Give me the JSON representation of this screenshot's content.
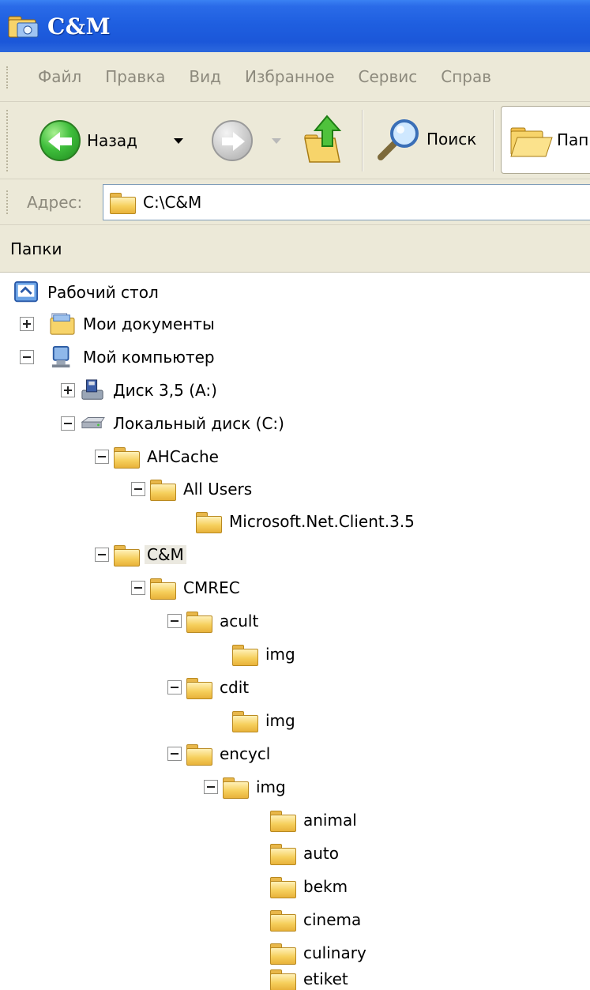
{
  "window": {
    "title": "C&M"
  },
  "menu": [
    "Файл",
    "Правка",
    "Вид",
    "Избранное",
    "Сервис",
    "Справ"
  ],
  "toolbar": {
    "back_label": "Назад",
    "search_label": "Поиск",
    "folders_label": "Пап"
  },
  "address": {
    "label": "Адрес:",
    "value": "C:\\C&M"
  },
  "pane": {
    "title": "Папки"
  },
  "tree": [
    {
      "label": "Рабочий стол"
    },
    {
      "label": "Мои документы"
    },
    {
      "label": "Мой компьютер"
    },
    {
      "label": "Диск 3,5 (A:)"
    },
    {
      "label": "Локальный диск (C:)"
    },
    {
      "label": "AHCache"
    },
    {
      "label": "All Users"
    },
    {
      "label": "Microsoft.Net.Client.3.5"
    },
    {
      "label": "C&M"
    },
    {
      "label": "CMREC"
    },
    {
      "label": "acult"
    },
    {
      "label": "img"
    },
    {
      "label": "cdit"
    },
    {
      "label": "img"
    },
    {
      "label": "encycl"
    },
    {
      "label": "img"
    },
    {
      "label": "animal"
    },
    {
      "label": "auto"
    },
    {
      "label": "bekm"
    },
    {
      "label": "cinema"
    },
    {
      "label": "culinary"
    },
    {
      "label": "etiket"
    }
  ]
}
